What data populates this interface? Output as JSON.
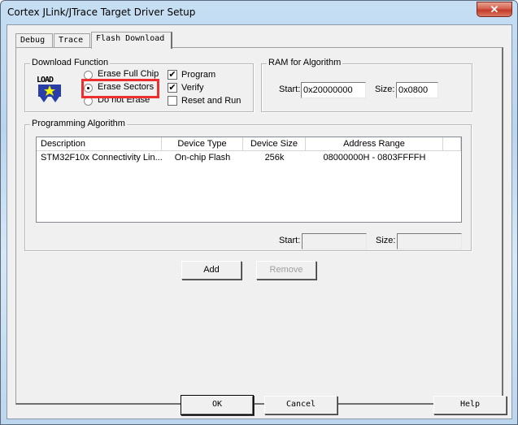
{
  "window": {
    "title": "Cortex JLink/JTrace Target Driver Setup",
    "close_icon": "close-icon"
  },
  "tabs": [
    {
      "label": "Debug",
      "active": false
    },
    {
      "label": "Trace",
      "active": false
    },
    {
      "label": "Flash Download",
      "active": true
    }
  ],
  "download_function": {
    "label": "Download Function",
    "icon": "load-icon",
    "icon_text": "LOAD",
    "erase_options": [
      {
        "label": "Erase Full Chip",
        "checked": false
      },
      {
        "label": "Erase Sectors",
        "checked": true
      },
      {
        "label": "Do not Erase",
        "checked": false
      }
    ],
    "checks": [
      {
        "label": "Program",
        "checked": true
      },
      {
        "label": "Verify",
        "checked": true
      },
      {
        "label": "Reset and Run",
        "checked": false
      }
    ],
    "highlight_color": "#ee2f2f"
  },
  "ram_for_algorithm": {
    "label": "RAM for Algorithm",
    "start_label": "Start:",
    "start_value": "0x20000000",
    "size_label": "Size:",
    "size_value": "0x0800"
  },
  "programming_algorithm": {
    "label": "Programming Algorithm",
    "columns": [
      "Description",
      "Device Type",
      "Device Size",
      "Address Range"
    ],
    "rows": [
      [
        "STM32F10x Connectivity Lin...",
        "On-chip Flash",
        "256k",
        "08000000H - 0803FFFFH"
      ]
    ],
    "start_label": "Start:",
    "start_value": "",
    "size_label": "Size:",
    "size_value": ""
  },
  "buttons": {
    "add": "Add",
    "remove": "Remove",
    "ok": "OK",
    "cancel": "Cancel",
    "help": "Help"
  }
}
